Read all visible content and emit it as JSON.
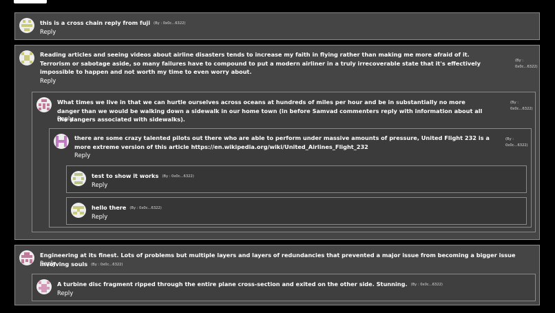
{
  "comments": [
    {
      "id": "c1",
      "text": "this is a cross chain reply from fuji",
      "by": "(By : 0x0c...6322)",
      "reply": "Reply",
      "avatar": {
        "icon": "identicon-avatar",
        "color": "#c9c97a"
      }
    },
    {
      "id": "c2",
      "text": "Reading articles and seeing videos about airline disasters tends to increase my faith in flying rather than making me more afraid of it. Terrorism or sabotage aside, so many failures have to compound to put a modern airliner in a truly irrecoverable state that it's effectively impossible to happen and not worth my time to even worry about.",
      "by_lines": [
        "(By :",
        "0x0c...6322)"
      ],
      "reply": "Reply",
      "avatar": {
        "icon": "identicon-avatar",
        "color": "#c9c97a"
      }
    },
    {
      "id": "c3",
      "text": "What times we live in that we can hurtle ourselves across oceans at hundreds of miles per hour and be in substantially no more danger than we would be walking down a sidewalk in our home town (in before Samvad commenters reply with information about all the dangers associated with sidewalks).",
      "by_lines": [
        "(By :",
        "0x0c...6322)"
      ],
      "reply": "Reply",
      "avatar": {
        "icon": "identicon-avatar",
        "color": "#c07a9a"
      }
    },
    {
      "id": "c4",
      "text": "there are some crazy talented pilots out there who are able to perform under massive amounts of pressure, United Flight 232 is a more extreme version of this article https://en.wikipedia.org/wiki/United_Airlines_Flight_232",
      "by_lines": [
        "(By :",
        "0x0c...6322)"
      ],
      "reply": "Reply",
      "avatar": {
        "icon": "identicon-avatar",
        "color": "#c07ac0"
      }
    },
    {
      "id": "c5",
      "text": "test to show it works",
      "by": "(By : 0x0c...6322)",
      "reply": "Reply",
      "avatar": {
        "icon": "identicon-avatar",
        "color": "#b8c48a"
      }
    },
    {
      "id": "c6",
      "text": "hello there",
      "by": "(By : 0x0c...6322)",
      "reply": "Reply",
      "avatar": {
        "icon": "identicon-avatar",
        "color": "#c9c97a"
      }
    },
    {
      "id": "c7",
      "text": "Engineering at its finest. Lots of problems but multiple layers and layers of redundancies that prevented a major issue from becoming a bigger issue involving souls",
      "by": "(By : 0x0c...6322)",
      "reply": "Reply",
      "avatar": {
        "icon": "identicon-avatar",
        "color": "#c07a9a"
      }
    },
    {
      "id": "c8",
      "text": "A turbine disc fragment ripped through the entire plane cross-section and exited on the other side. Stunning.",
      "by": "(By : 0x0c...6322)",
      "reply": "Reply",
      "avatar": {
        "icon": "identicon-avatar",
        "color": "#d49ab8"
      }
    }
  ]
}
